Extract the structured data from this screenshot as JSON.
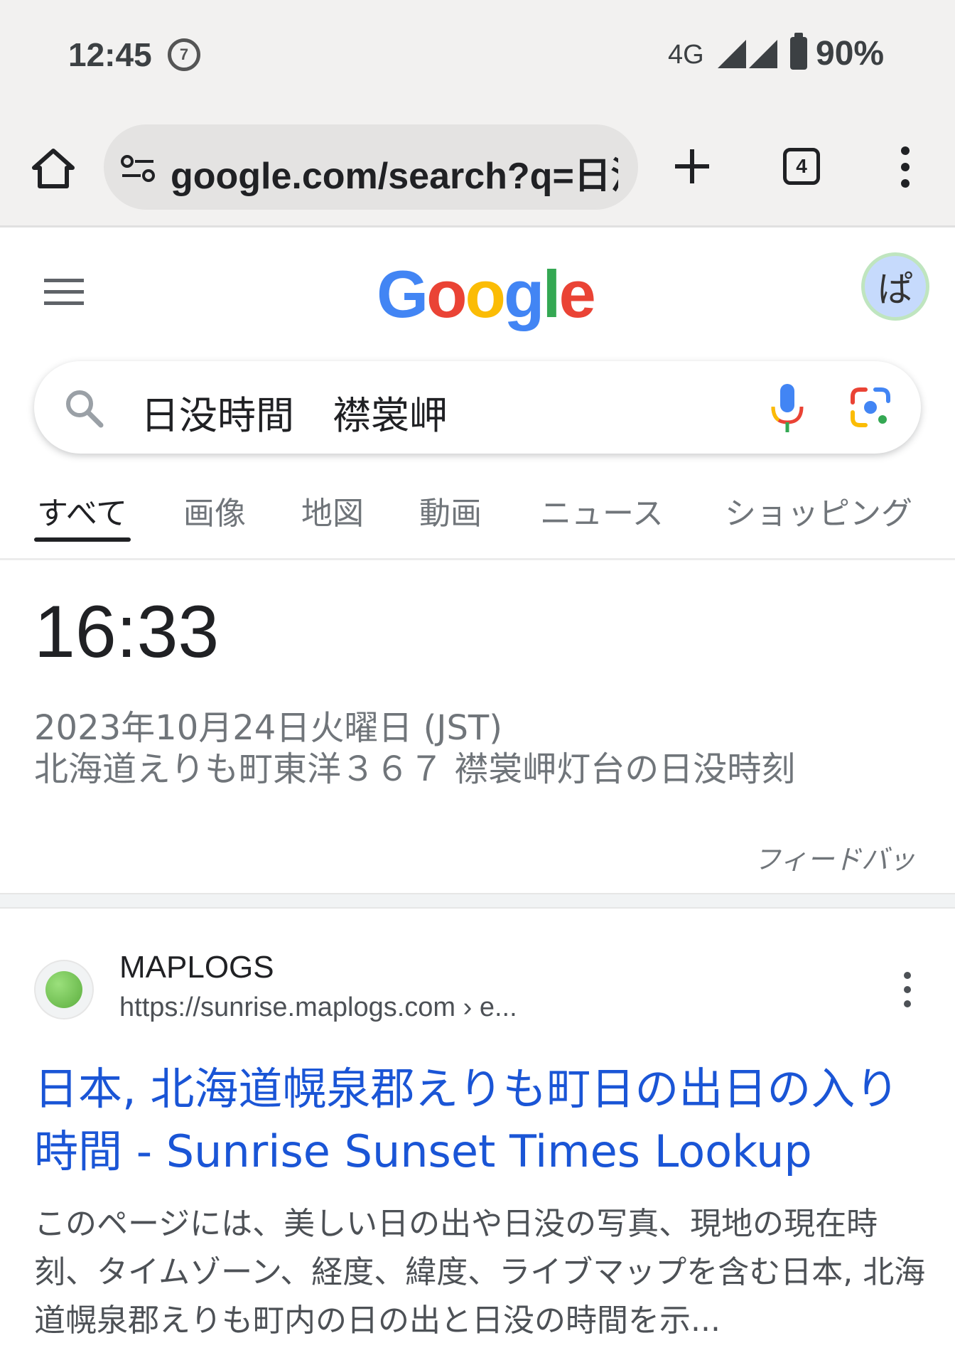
{
  "status_bar": {
    "time": "12:45",
    "store_icon": "7",
    "network": "4G",
    "battery": "90%"
  },
  "browser": {
    "url": "google.com/search?q=日没",
    "tab_count": "4",
    "icons": [
      "home-icon",
      "tune-icon",
      "plus-icon",
      "tab-switcher-icon",
      "more-vert-icon"
    ]
  },
  "google": {
    "logo_letters": [
      "G",
      "o",
      "o",
      "g",
      "l",
      "e"
    ],
    "logo_colors": [
      "#4285F4",
      "#EA4335",
      "#FBBC05",
      "#4285F4",
      "#34A853",
      "#EA4335"
    ],
    "avatar_text": "ぱ"
  },
  "search": {
    "query": "日没時間　襟裳岬"
  },
  "tabs": [
    {
      "label": "すべて",
      "active": true
    },
    {
      "label": "画像",
      "active": false
    },
    {
      "label": "地図",
      "active": false
    },
    {
      "label": "動画",
      "active": false
    },
    {
      "label": "ニュース",
      "active": false
    },
    {
      "label": "ショッピング",
      "active": false
    }
  ],
  "answer": {
    "time": "16:33",
    "date": "2023年10月24日火曜日 (JST)",
    "location": "北海道えりも町東洋３６７ 襟裳岬灯台の日没時刻",
    "feedback": "フィードバッ"
  },
  "result": {
    "site_name": "MAPLOGS",
    "url": "https://sunrise.maplogs.com › e...",
    "title": "日本, 北海道幌泉郡えりも町日の出日の入り時間 - Sunrise Sunset Times Lookup",
    "snippet": "このページには、美しい日の出や日没の写真、現地の現在時刻、タイムゾーン、経度、緯度、ライブマップを含む日本, 北海道幌泉郡えりも町内の日の出と日没の時間を示..."
  },
  "colors": {
    "link": "#1a55d6",
    "chrome_bg": "#f2f1f0",
    "secondary_text": "#70757a"
  }
}
